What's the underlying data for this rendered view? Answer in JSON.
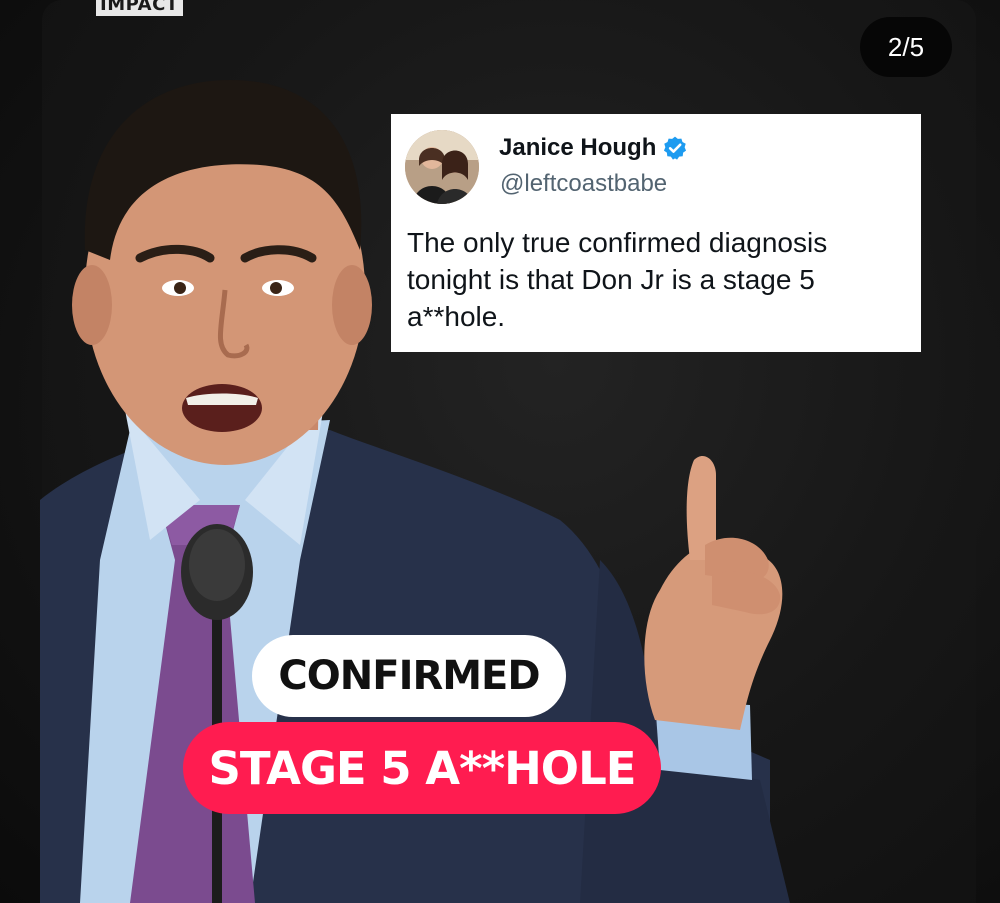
{
  "brand": {
    "tag": "IMPACT"
  },
  "pager": {
    "counter": "2/5"
  },
  "tweet": {
    "display_name": "Janice Hough",
    "handle": "@leftcoastbabe",
    "verified": true,
    "text": "The only true confirmed diagnosis tonight is that Don Jr is a stage 5 a**hole."
  },
  "captions": {
    "top": "CONFIRMED",
    "bottom": "STAGE 5 A**HOLE"
  },
  "colors": {
    "background": "#161616",
    "caption_white_bg": "#ffffff",
    "caption_red_bg": "#ff1c50",
    "verified_badge": "#1d9bf0",
    "pager_bg": "#060606"
  },
  "icons": {
    "verified": "verified-badge-icon"
  }
}
